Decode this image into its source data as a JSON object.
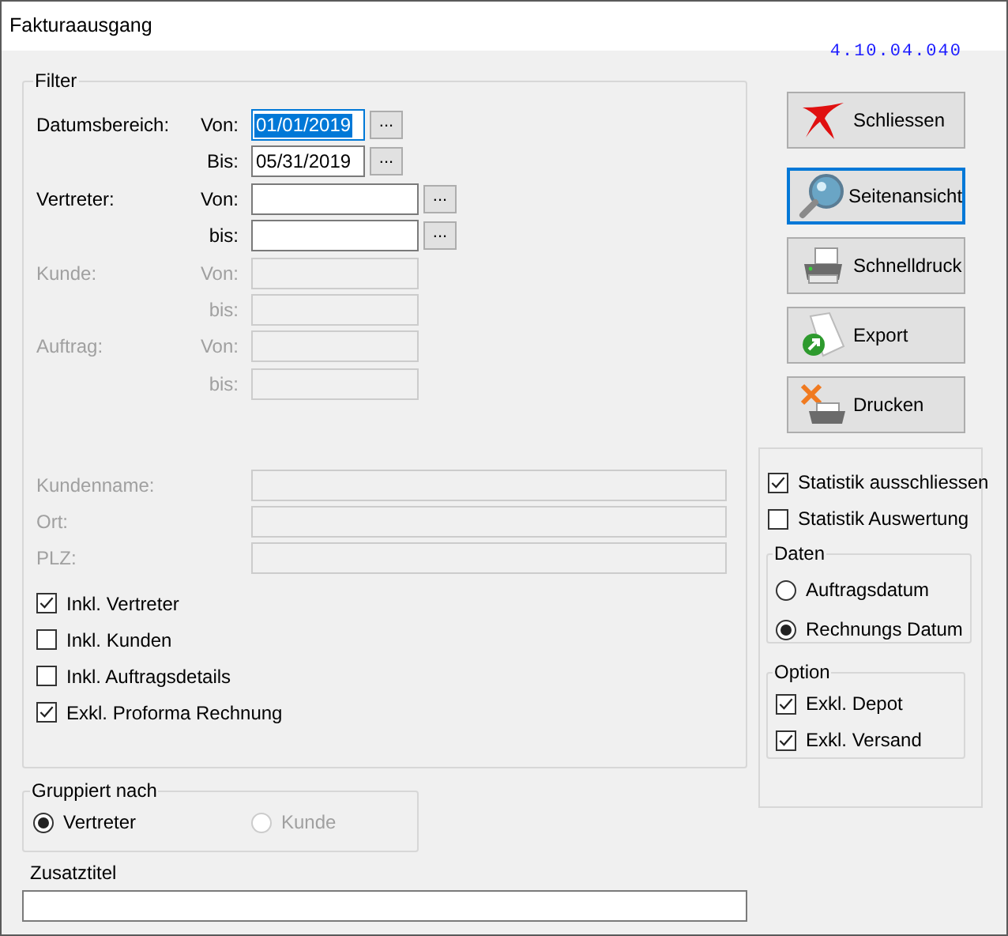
{
  "window": {
    "title": "Fakturaausgang"
  },
  "version": "4.10.04.040",
  "filter": {
    "title": "Filter",
    "ranges": [
      {
        "label": "Datumsbereich:",
        "kind": "date",
        "disabled": false,
        "rows": [
          {
            "label": "Von:",
            "value": "01/01/2019",
            "focused": true,
            "picker": "..."
          },
          {
            "label": "Bis:",
            "value": "05/31/2019",
            "focused": false,
            "picker": "..."
          }
        ]
      },
      {
        "label": "Vertreter:",
        "kind": "text",
        "disabled": false,
        "rows": [
          {
            "label": "Von:",
            "picker": "..."
          },
          {
            "label": "bis:",
            "picker": "..."
          }
        ]
      },
      {
        "label": "Kunde:",
        "kind": "text",
        "disabled": true,
        "rows": [
          {
            "label": "Von:"
          },
          {
            "label": "bis:"
          }
        ]
      },
      {
        "label": "Auftrag:",
        "kind": "text",
        "disabled": true,
        "rows": [
          {
            "label": "Von:"
          },
          {
            "label": "bis:"
          }
        ]
      }
    ],
    "text_fields": [
      {
        "label": "Kundenname:",
        "disabled": true
      },
      {
        "label": "Ort:",
        "disabled": true
      },
      {
        "label": "PLZ:",
        "disabled": true
      }
    ],
    "checkboxes": [
      {
        "label": "Inkl. Vertreter",
        "checked": true
      },
      {
        "label": "Inkl. Kunden",
        "checked": false
      },
      {
        "label": "Inkl. Auftragsdetails",
        "checked": false
      },
      {
        "label": "Exkl. Proforma Rechnung",
        "checked": true
      }
    ]
  },
  "grouping": {
    "title": "Gruppiert nach",
    "options": [
      {
        "label": "Vertreter",
        "selected": true,
        "disabled": false
      },
      {
        "label": "Kunde",
        "selected": false,
        "disabled": true
      }
    ]
  },
  "extra_title": {
    "label": "Zusatztitel"
  },
  "buttons": [
    {
      "label": "Schliessen",
      "focused": false
    },
    {
      "label": "Seitenansicht",
      "focused": true
    },
    {
      "label": "Schnelldruck",
      "focused": false
    },
    {
      "label": "Export",
      "focused": false
    },
    {
      "label": "Drucken",
      "focused": false
    }
  ],
  "statistics": [
    {
      "label": "Statistik ausschliessen",
      "checked": true
    },
    {
      "label": "Statistik Auswertung",
      "checked": false
    }
  ],
  "daten": {
    "title": "Daten",
    "options": [
      {
        "label": "Auftragsdatum",
        "selected": false
      },
      {
        "label": "Rechnungs Datum",
        "selected": true
      }
    ]
  },
  "option": {
    "title": "Option",
    "checkboxes": [
      {
        "label": "Exkl. Depot",
        "checked": true
      },
      {
        "label": "Exkl. Versand",
        "checked": true
      }
    ]
  }
}
